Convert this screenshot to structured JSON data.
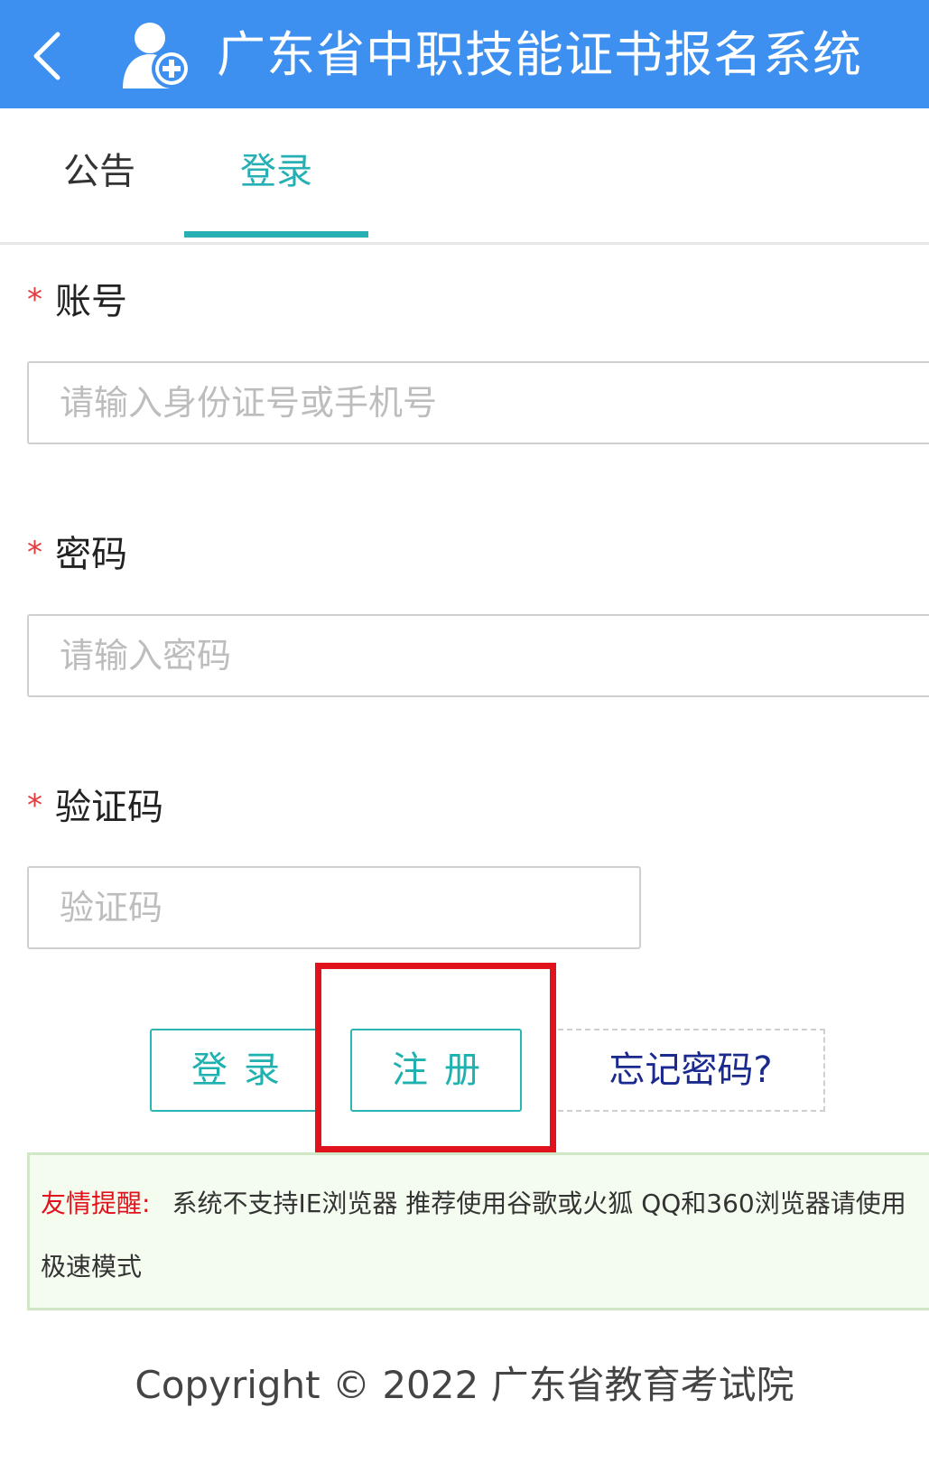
{
  "header": {
    "back_icon": "chevron-left-icon",
    "logo_icon": "user-add-icon",
    "title": "广东省中职技能证书报名系统",
    "background_color": "#3d8ff0"
  },
  "tabs": [
    {
      "label": "公告",
      "active": false
    },
    {
      "label": "登录",
      "active": true
    }
  ],
  "accent_color": "#27b0b4",
  "form": {
    "required_mark": "*",
    "account": {
      "label": "账号",
      "placeholder": "请输入身份证号或手机号",
      "value": ""
    },
    "password": {
      "label": "密码",
      "placeholder": "请输入密码",
      "value": ""
    },
    "captcha": {
      "label": "验证码",
      "placeholder": "验证码",
      "value": ""
    }
  },
  "buttons": {
    "login": "登录",
    "register": "注册",
    "forgot": "忘记密码?"
  },
  "highlight_color": "#e0121c",
  "notice": {
    "title": "友情提醒:",
    "text": "系统不支持IE浏览器 推荐使用谷歌或火狐 QQ和360浏览器请使用",
    "text_cont": "极速模式"
  },
  "footer": {
    "copyright": "Copyright © 2022 广东省教育考试院"
  }
}
